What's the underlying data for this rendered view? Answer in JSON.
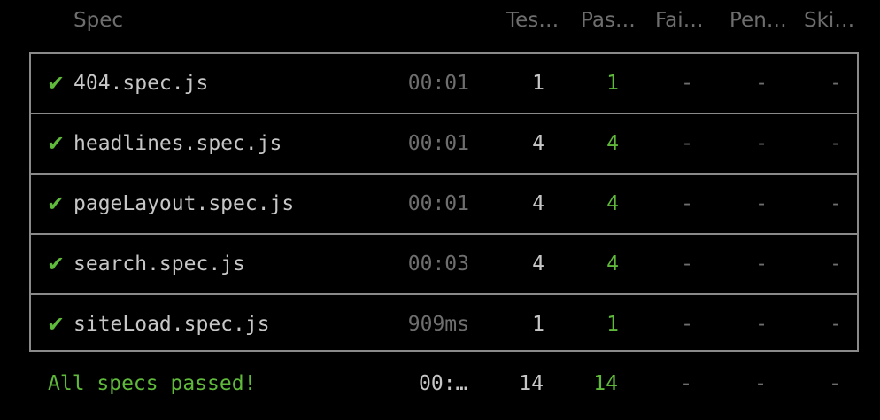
{
  "header": {
    "spec": "Spec",
    "tests": "Tes…",
    "passing": "Pas…",
    "failing": "Fai…",
    "pending": "Pen…",
    "skipped": "Ski…"
  },
  "rows": [
    {
      "check": "✔",
      "name": "404.spec.js",
      "duration": "00:01",
      "tests": "1",
      "passing": "1",
      "failing": "-",
      "pending": "-",
      "skipped": "-"
    },
    {
      "check": "✔",
      "name": "headlines.spec.js",
      "duration": "00:01",
      "tests": "4",
      "passing": "4",
      "failing": "-",
      "pending": "-",
      "skipped": "-"
    },
    {
      "check": "✔",
      "name": "pageLayout.spec.js",
      "duration": "00:01",
      "tests": "4",
      "passing": "4",
      "failing": "-",
      "pending": "-",
      "skipped": "-"
    },
    {
      "check": "✔",
      "name": "search.spec.js",
      "duration": "00:03",
      "tests": "4",
      "passing": "4",
      "failing": "-",
      "pending": "-",
      "skipped": "-"
    },
    {
      "check": "✔",
      "name": "siteLoad.spec.js",
      "duration": "909ms",
      "tests": "1",
      "passing": "1",
      "failing": "-",
      "pending": "-",
      "skipped": "-"
    }
  ],
  "footer": {
    "message": "All specs passed!",
    "duration": "00:…",
    "tests": "14",
    "passing": "14",
    "failing": "-",
    "pending": "-",
    "skipped": "-"
  },
  "colors": {
    "background": "#000000",
    "pass_green": "#5fb93a",
    "muted_gray": "#6e6e6e",
    "text": "#c7c7c7",
    "border": "#8a8a8a"
  },
  "icons": {
    "check": "check-icon"
  }
}
